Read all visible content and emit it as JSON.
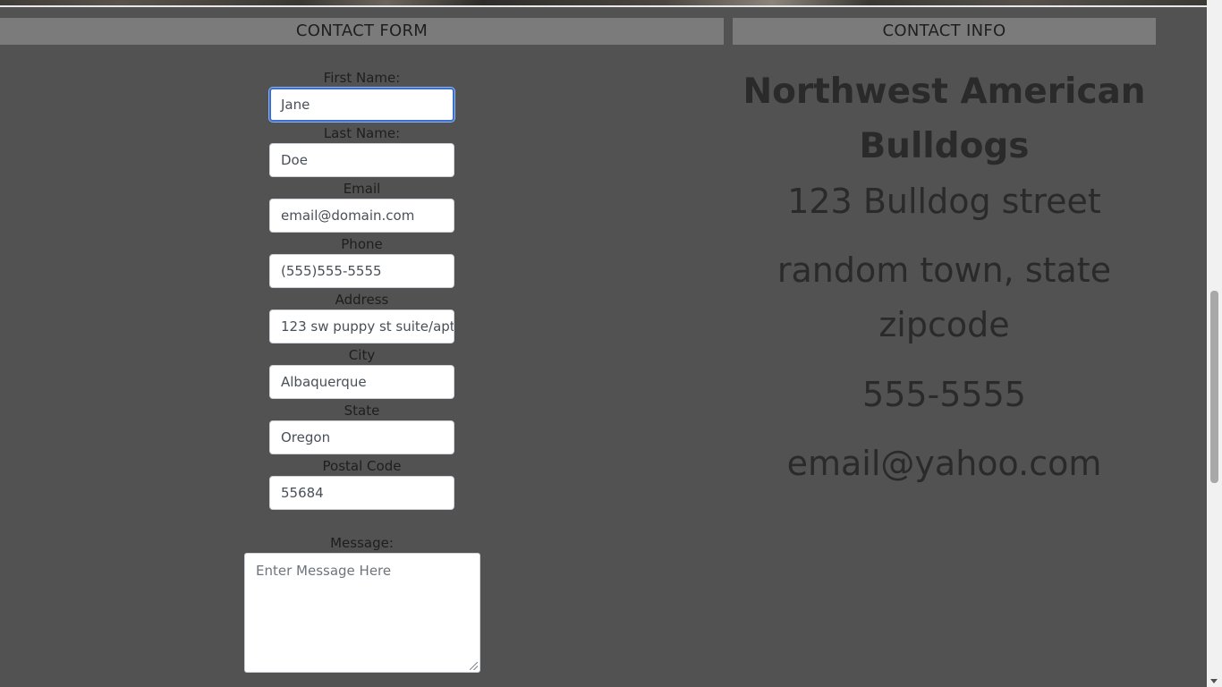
{
  "headers": {
    "contact_form": "CONTACT FORM",
    "contact_info": "CONTACT INFO"
  },
  "form": {
    "first_name": {
      "label": "First Name:",
      "value": "Jane"
    },
    "last_name": {
      "label": "Last Name:",
      "value": "Doe"
    },
    "email": {
      "label": "Email",
      "placeholder": "email@domain.com"
    },
    "phone": {
      "label": "Phone",
      "placeholder": "(555)555-5555"
    },
    "address": {
      "label": "Address",
      "placeholder": "123 sw puppy st suite/apt"
    },
    "city": {
      "label": "City",
      "placeholder": "Albaquerque"
    },
    "state": {
      "label": "State",
      "placeholder": "Oregon"
    },
    "postal_code": {
      "label": "Postal Code",
      "placeholder": "55684"
    },
    "message": {
      "label": "Message:",
      "placeholder": "Enter Message Here"
    }
  },
  "info": {
    "business_name": "Northwest American Bulldogs",
    "street": "123 Bulldog street",
    "city_state_zip": "random town, state zipcode",
    "phone": "555-5555",
    "email": "email@yahoo.com"
  },
  "colors": {
    "page_background": "#525252",
    "header_background": "#7b7b7b",
    "focus_ring": "#3b6fd0"
  }
}
